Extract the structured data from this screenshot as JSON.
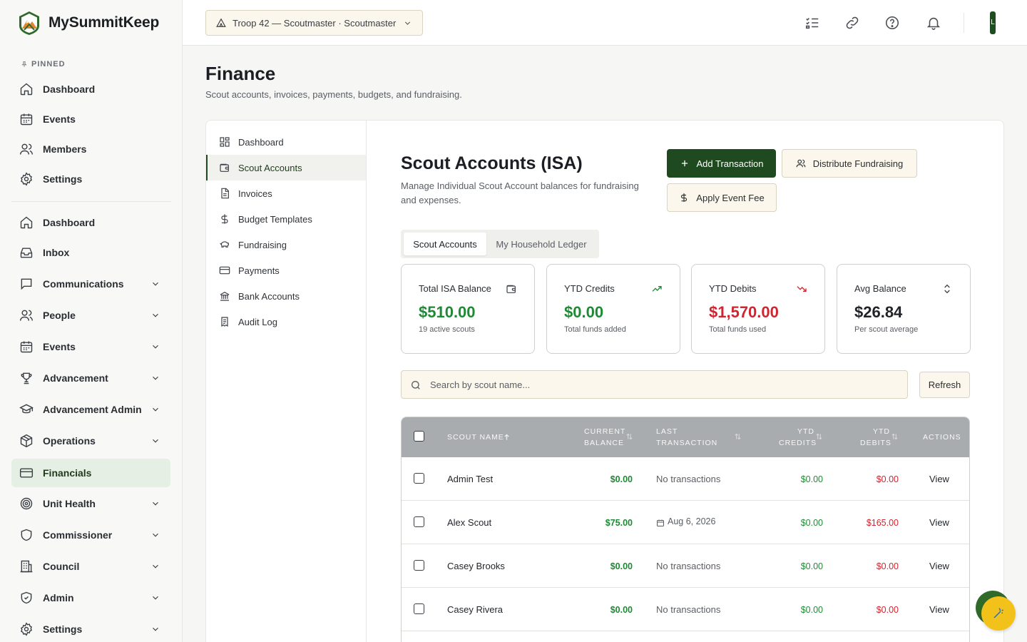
{
  "brand": {
    "name": "MySummitKeep"
  },
  "sidebar": {
    "pinned_label": "PINNED",
    "pinned": [
      {
        "label": "Dashboard",
        "icon": "home-icon"
      },
      {
        "label": "Events",
        "icon": "calendar-icon"
      },
      {
        "label": "Members",
        "icon": "users-icon"
      },
      {
        "label": "Settings",
        "icon": "gear-icon"
      }
    ],
    "items": [
      {
        "label": "Dashboard",
        "icon": "home-icon"
      },
      {
        "label": "Inbox",
        "icon": "inbox-icon"
      },
      {
        "label": "Communications",
        "icon": "message-icon",
        "expandable": true
      },
      {
        "label": "People",
        "icon": "users-icon",
        "expandable": true
      },
      {
        "label": "Events",
        "icon": "calendar-icon",
        "expandable": true
      },
      {
        "label": "Advancement",
        "icon": "trophy-icon",
        "expandable": true
      },
      {
        "label": "Advancement Admin",
        "icon": "graduation-cap-icon",
        "expandable": true
      },
      {
        "label": "Operations",
        "icon": "package-icon",
        "expandable": true
      },
      {
        "label": "Financials",
        "icon": "credit-card-icon",
        "active": true
      },
      {
        "label": "Unit Health",
        "icon": "target-icon",
        "expandable": true
      },
      {
        "label": "Commissioner",
        "icon": "shield-icon",
        "expandable": true
      },
      {
        "label": "Council",
        "icon": "building-icon",
        "expandable": true
      },
      {
        "label": "Admin",
        "icon": "shield-check-icon",
        "expandable": true
      },
      {
        "label": "Settings",
        "icon": "gear-icon",
        "expandable": true
      }
    ]
  },
  "topbar": {
    "troop_select": "Troop 42 — Scoutmaster · Scoutmaster",
    "icons": [
      "checklist-icon",
      "link-icon",
      "help-icon",
      "bell-icon"
    ],
    "avatar_initial": "L"
  },
  "page": {
    "title": "Finance",
    "subtitle": "Scout accounts, invoices, payments, budgets, and fundraising."
  },
  "subnav": [
    {
      "label": "Dashboard",
      "icon": "grid-icon"
    },
    {
      "label": "Scout Accounts",
      "icon": "wallet-icon",
      "active": true
    },
    {
      "label": "Invoices",
      "icon": "file-icon"
    },
    {
      "label": "Budget Templates",
      "icon": "dollar-icon"
    },
    {
      "label": "Fundraising",
      "icon": "piggy-bank-icon"
    },
    {
      "label": "Payments",
      "icon": "credit-card-icon"
    },
    {
      "label": "Bank Accounts",
      "icon": "bank-icon"
    },
    {
      "label": "Audit Log",
      "icon": "receipt-icon"
    }
  ],
  "section": {
    "title": "Scout Accounts (ISA)",
    "subtitle": "Manage Individual Scout Account balances for fundraising and expenses.",
    "buttons": {
      "add": "Add Transaction",
      "distribute": "Distribute Fundraising",
      "apply_fee": "Apply Event Fee"
    },
    "tabs": [
      "Scout Accounts",
      "My Household Ledger"
    ],
    "active_tab": "Scout Accounts"
  },
  "stats": [
    {
      "label": "Total ISA Balance",
      "value": "$510.00",
      "note": "19 active scouts",
      "icon": "wallet-icon",
      "color": "#1f8a35"
    },
    {
      "label": "YTD Credits",
      "value": "$0.00",
      "note": "Total funds added",
      "icon": "trending-up-icon",
      "color": "#1f8a35"
    },
    {
      "label": "YTD Debits",
      "value": "$1,570.00",
      "note": "Total funds used",
      "icon": "trending-down-icon",
      "color": "#d1242f"
    },
    {
      "label": "Avg Balance",
      "value": "$26.84",
      "note": "Per scout average",
      "icon": "sort-icon",
      "color": "#1f2328"
    }
  ],
  "search": {
    "placeholder": "Search by scout name...",
    "refresh": "Refresh"
  },
  "table": {
    "headers": {
      "name": "SCOUT NAME",
      "balance_1": "CURRENT",
      "balance_2": "BALANCE",
      "last_1": "LAST",
      "last_2": "TRANSACTION",
      "credits_1": "YTD",
      "credits_2": "CREDITS",
      "debits_1": "YTD",
      "debits_2": "DEBITS",
      "actions": "ACTIONS"
    },
    "rows": [
      {
        "name": "Admin Test",
        "balance": "$0.00",
        "last": "No transactions",
        "credits": "$0.00",
        "debits": "$0.00",
        "action": "View"
      },
      {
        "name": "Alex Scout",
        "balance": "$75.00",
        "last": "Aug 6, 2026",
        "credits": "$0.00",
        "debits": "$165.00",
        "action": "View"
      },
      {
        "name": "Casey Brooks",
        "balance": "$0.00",
        "last": "No transactions",
        "credits": "$0.00",
        "debits": "$0.00",
        "action": "View"
      },
      {
        "name": "Casey Rivera",
        "balance": "$0.00",
        "last": "No transactions",
        "credits": "$0.00",
        "debits": "$0.00",
        "action": "View"
      }
    ]
  },
  "colors": {
    "brand_green": "#1f4a1f",
    "credit_green": "#1f8a35",
    "debit_red": "#d1242f",
    "input_bg": "#fbf7ec"
  }
}
